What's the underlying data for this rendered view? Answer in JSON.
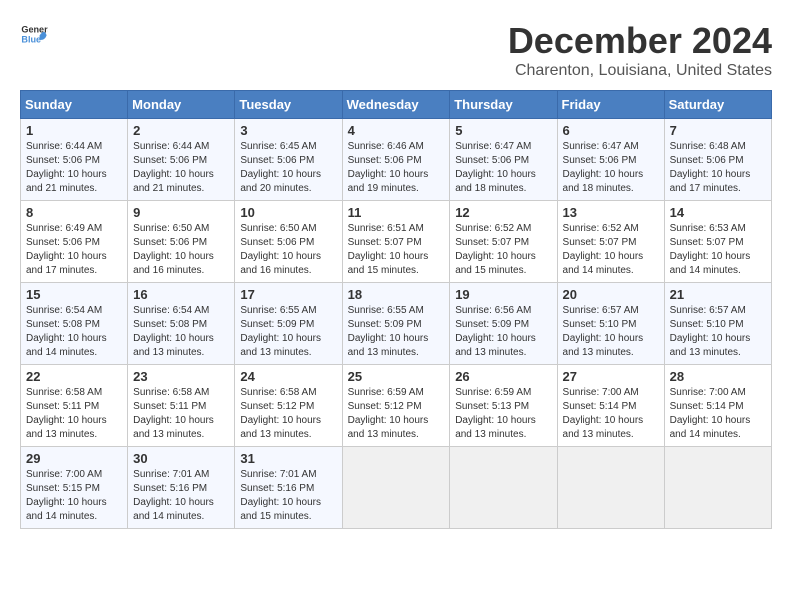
{
  "header": {
    "logo_general": "General",
    "logo_blue": "Blue",
    "month": "December 2024",
    "location": "Charenton, Louisiana, United States"
  },
  "weekdays": [
    "Sunday",
    "Monday",
    "Tuesday",
    "Wednesday",
    "Thursday",
    "Friday",
    "Saturday"
  ],
  "weeks": [
    [
      {
        "day": "1",
        "sunrise": "6:44 AM",
        "sunset": "5:06 PM",
        "daylight": "10 hours and 21 minutes."
      },
      {
        "day": "2",
        "sunrise": "6:44 AM",
        "sunset": "5:06 PM",
        "daylight": "10 hours and 21 minutes."
      },
      {
        "day": "3",
        "sunrise": "6:45 AM",
        "sunset": "5:06 PM",
        "daylight": "10 hours and 20 minutes."
      },
      {
        "day": "4",
        "sunrise": "6:46 AM",
        "sunset": "5:06 PM",
        "daylight": "10 hours and 19 minutes."
      },
      {
        "day": "5",
        "sunrise": "6:47 AM",
        "sunset": "5:06 PM",
        "daylight": "10 hours and 18 minutes."
      },
      {
        "day": "6",
        "sunrise": "6:47 AM",
        "sunset": "5:06 PM",
        "daylight": "10 hours and 18 minutes."
      },
      {
        "day": "7",
        "sunrise": "6:48 AM",
        "sunset": "5:06 PM",
        "daylight": "10 hours and 17 minutes."
      }
    ],
    [
      {
        "day": "8",
        "sunrise": "6:49 AM",
        "sunset": "5:06 PM",
        "daylight": "10 hours and 17 minutes."
      },
      {
        "day": "9",
        "sunrise": "6:50 AM",
        "sunset": "5:06 PM",
        "daylight": "10 hours and 16 minutes."
      },
      {
        "day": "10",
        "sunrise": "6:50 AM",
        "sunset": "5:06 PM",
        "daylight": "10 hours and 16 minutes."
      },
      {
        "day": "11",
        "sunrise": "6:51 AM",
        "sunset": "5:07 PM",
        "daylight": "10 hours and 15 minutes."
      },
      {
        "day": "12",
        "sunrise": "6:52 AM",
        "sunset": "5:07 PM",
        "daylight": "10 hours and 15 minutes."
      },
      {
        "day": "13",
        "sunrise": "6:52 AM",
        "sunset": "5:07 PM",
        "daylight": "10 hours and 14 minutes."
      },
      {
        "day": "14",
        "sunrise": "6:53 AM",
        "sunset": "5:07 PM",
        "daylight": "10 hours and 14 minutes."
      }
    ],
    [
      {
        "day": "15",
        "sunrise": "6:54 AM",
        "sunset": "5:08 PM",
        "daylight": "10 hours and 14 minutes."
      },
      {
        "day": "16",
        "sunrise": "6:54 AM",
        "sunset": "5:08 PM",
        "daylight": "10 hours and 13 minutes."
      },
      {
        "day": "17",
        "sunrise": "6:55 AM",
        "sunset": "5:09 PM",
        "daylight": "10 hours and 13 minutes."
      },
      {
        "day": "18",
        "sunrise": "6:55 AM",
        "sunset": "5:09 PM",
        "daylight": "10 hours and 13 minutes."
      },
      {
        "day": "19",
        "sunrise": "6:56 AM",
        "sunset": "5:09 PM",
        "daylight": "10 hours and 13 minutes."
      },
      {
        "day": "20",
        "sunrise": "6:57 AM",
        "sunset": "5:10 PM",
        "daylight": "10 hours and 13 minutes."
      },
      {
        "day": "21",
        "sunrise": "6:57 AM",
        "sunset": "5:10 PM",
        "daylight": "10 hours and 13 minutes."
      }
    ],
    [
      {
        "day": "22",
        "sunrise": "6:58 AM",
        "sunset": "5:11 PM",
        "daylight": "10 hours and 13 minutes."
      },
      {
        "day": "23",
        "sunrise": "6:58 AM",
        "sunset": "5:11 PM",
        "daylight": "10 hours and 13 minutes."
      },
      {
        "day": "24",
        "sunrise": "6:58 AM",
        "sunset": "5:12 PM",
        "daylight": "10 hours and 13 minutes."
      },
      {
        "day": "25",
        "sunrise": "6:59 AM",
        "sunset": "5:12 PM",
        "daylight": "10 hours and 13 minutes."
      },
      {
        "day": "26",
        "sunrise": "6:59 AM",
        "sunset": "5:13 PM",
        "daylight": "10 hours and 13 minutes."
      },
      {
        "day": "27",
        "sunrise": "7:00 AM",
        "sunset": "5:14 PM",
        "daylight": "10 hours and 13 minutes."
      },
      {
        "day": "28",
        "sunrise": "7:00 AM",
        "sunset": "5:14 PM",
        "daylight": "10 hours and 14 minutes."
      }
    ],
    [
      {
        "day": "29",
        "sunrise": "7:00 AM",
        "sunset": "5:15 PM",
        "daylight": "10 hours and 14 minutes."
      },
      {
        "day": "30",
        "sunrise": "7:01 AM",
        "sunset": "5:16 PM",
        "daylight": "10 hours and 14 minutes."
      },
      {
        "day": "31",
        "sunrise": "7:01 AM",
        "sunset": "5:16 PM",
        "daylight": "10 hours and 15 minutes."
      },
      null,
      null,
      null,
      null
    ]
  ]
}
